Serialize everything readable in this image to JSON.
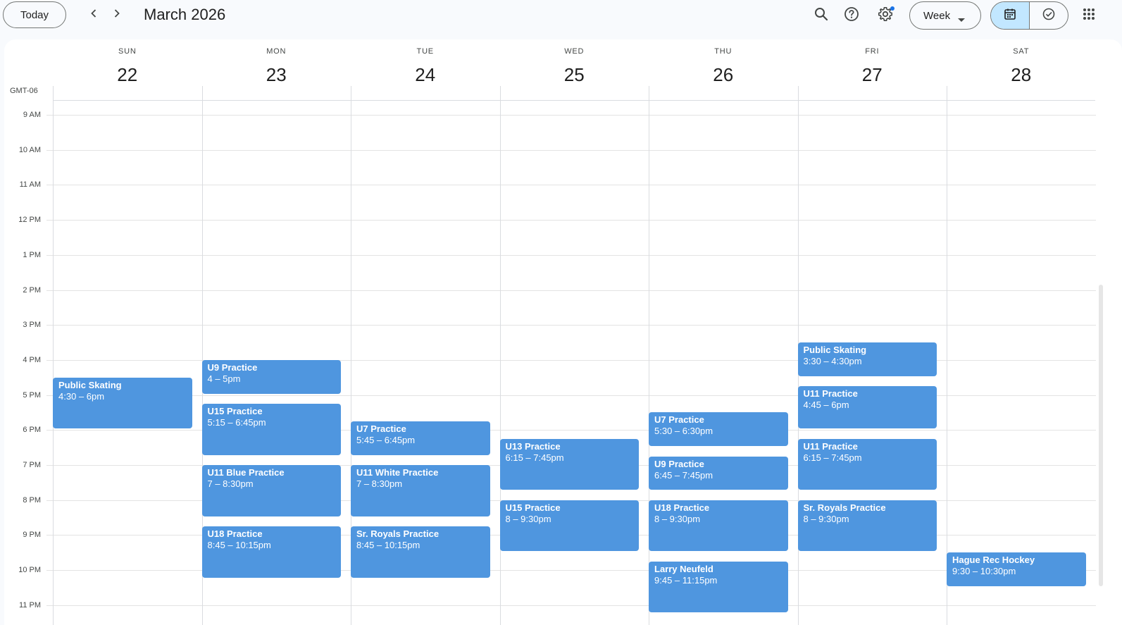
{
  "toolbar": {
    "today_label": "Today",
    "month_title": "March 2026",
    "view_label": "Week",
    "icons": [
      "chevron-left-icon",
      "chevron-right-icon",
      "search-icon",
      "help-icon",
      "settings-icon",
      "calendar-icon",
      "tasks-check-icon",
      "apps-grid-icon"
    ]
  },
  "colors": {
    "event": "#4f96df",
    "selected_toggle": "#c2e7ff",
    "notification_dot": "#1a73e8"
  },
  "timezone": "GMT-06",
  "days": [
    {
      "dow": "SUN",
      "num": "22"
    },
    {
      "dow": "MON",
      "num": "23"
    },
    {
      "dow": "TUE",
      "num": "24"
    },
    {
      "dow": "WED",
      "num": "25"
    },
    {
      "dow": "THU",
      "num": "26"
    },
    {
      "dow": "FRI",
      "num": "27"
    },
    {
      "dow": "SAT",
      "num": "28"
    }
  ],
  "hours": [
    "9 AM",
    "10 AM",
    "11 AM",
    "12 PM",
    "1 PM",
    "2 PM",
    "3 PM",
    "4 PM",
    "5 PM",
    "6 PM",
    "7 PM",
    "8 PM",
    "9 PM",
    "10 PM",
    "11 PM"
  ],
  "events": [
    {
      "day": 0,
      "start": 16.5,
      "end": 18,
      "title": "Public Skating",
      "time": "4:30 – 6pm"
    },
    {
      "day": 1,
      "start": 16,
      "end": 17,
      "title": "U9 Practice",
      "time": "4 – 5pm"
    },
    {
      "day": 1,
      "start": 17.25,
      "end": 18.75,
      "title": "U15 Practice",
      "time": "5:15 – 6:45pm"
    },
    {
      "day": 1,
      "start": 19,
      "end": 20.5,
      "title": "U11 Blue Practice",
      "time": "7 – 8:30pm"
    },
    {
      "day": 1,
      "start": 20.75,
      "end": 22.25,
      "title": "U18 Practice",
      "time": "8:45 – 10:15pm"
    },
    {
      "day": 2,
      "start": 17.75,
      "end": 18.75,
      "title": "U7 Practice",
      "time": "5:45 – 6:45pm"
    },
    {
      "day": 2,
      "start": 19,
      "end": 20.5,
      "title": "U11 White Practice",
      "time": "7 – 8:30pm"
    },
    {
      "day": 2,
      "start": 20.75,
      "end": 22.25,
      "title": "Sr. Royals Practice",
      "time": "8:45 – 10:15pm"
    },
    {
      "day": 3,
      "start": 18.25,
      "end": 19.75,
      "title": "U13 Practice",
      "time": "6:15 – 7:45pm"
    },
    {
      "day": 3,
      "start": 20,
      "end": 21.5,
      "title": "U15 Practice",
      "time": "8 – 9:30pm"
    },
    {
      "day": 4,
      "start": 17.5,
      "end": 18.5,
      "title": "U7 Practice",
      "time": "5:30 – 6:30pm"
    },
    {
      "day": 4,
      "start": 18.75,
      "end": 19.75,
      "title": "U9 Practice",
      "time": "6:45 – 7:45pm"
    },
    {
      "day": 4,
      "start": 20,
      "end": 21.5,
      "title": "U18 Practice",
      "time": "8 – 9:30pm"
    },
    {
      "day": 4,
      "start": 21.75,
      "end": 23.25,
      "title": "Larry Neufeld",
      "time": "9:45 – 11:15pm"
    },
    {
      "day": 5,
      "start": 15.5,
      "end": 16.5,
      "title": "Public Skating",
      "time": "3:30 – 4:30pm"
    },
    {
      "day": 5,
      "start": 16.75,
      "end": 18,
      "title": "U11 Practice",
      "time": "4:45 – 6pm"
    },
    {
      "day": 5,
      "start": 18.25,
      "end": 19.75,
      "title": "U11 Practice",
      "time": "6:15 – 7:45pm"
    },
    {
      "day": 5,
      "start": 20,
      "end": 21.5,
      "title": "Sr. Royals Practice",
      "time": "8 – 9:30pm"
    },
    {
      "day": 6,
      "start": 21.5,
      "end": 22.5,
      "title": "Hague Rec Hockey",
      "time": "9:30 – 10:30pm"
    }
  ]
}
